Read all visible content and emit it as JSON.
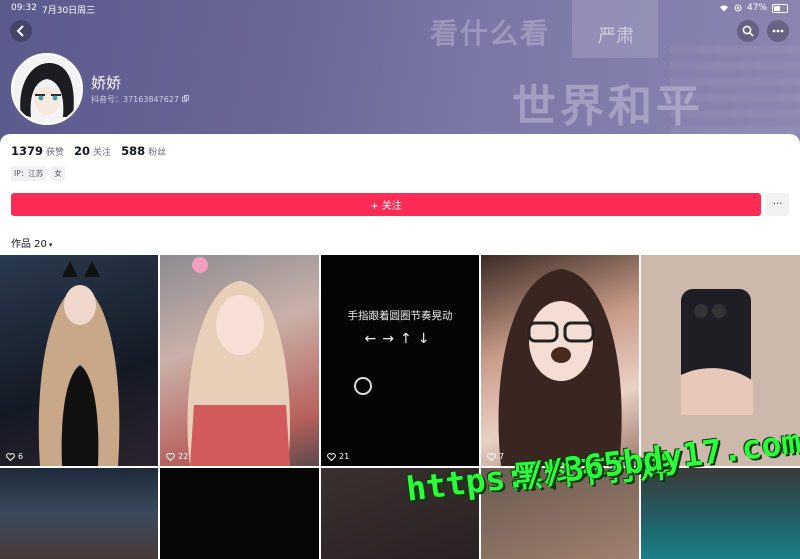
{
  "status_bar": {
    "time": "09:32",
    "date": "7月30日周三",
    "battery": "47%"
  },
  "banner": {
    "watermark_1": "看什么看",
    "watermark_2": "世界和平",
    "watermark_3": "严肃"
  },
  "profile": {
    "nickname": "娇娇",
    "douyin_id": "抖音号：37163847627",
    "stats": [
      {
        "value": "1379",
        "label": "获赞"
      },
      {
        "value": "20",
        "label": "关注"
      },
      {
        "value": "588",
        "label": "粉丝"
      }
    ],
    "tags": [
      "IP：江苏",
      "女"
    ]
  },
  "actions": {
    "follow_label": "+ 关注",
    "more_label": "···"
  },
  "works": {
    "label": "作品 20",
    "caret": "▾"
  },
  "grid": {
    "tiles": [
      {
        "likes": "6"
      },
      {
        "likes": "22"
      },
      {
        "likes": "21",
        "caption": "手指跟着圆圈节奏晃动",
        "arrows": "←→↑↓"
      },
      {
        "likes": "7"
      },
      {
        "likes": ""
      }
    ]
  },
  "overlay": {
    "line1": "黑料不打烊",
    "line2": "https://365bdy17.com"
  },
  "colors": {
    "accent": "#fe2c55",
    "banner": "#6a6698",
    "promo": "#2aff3a"
  }
}
